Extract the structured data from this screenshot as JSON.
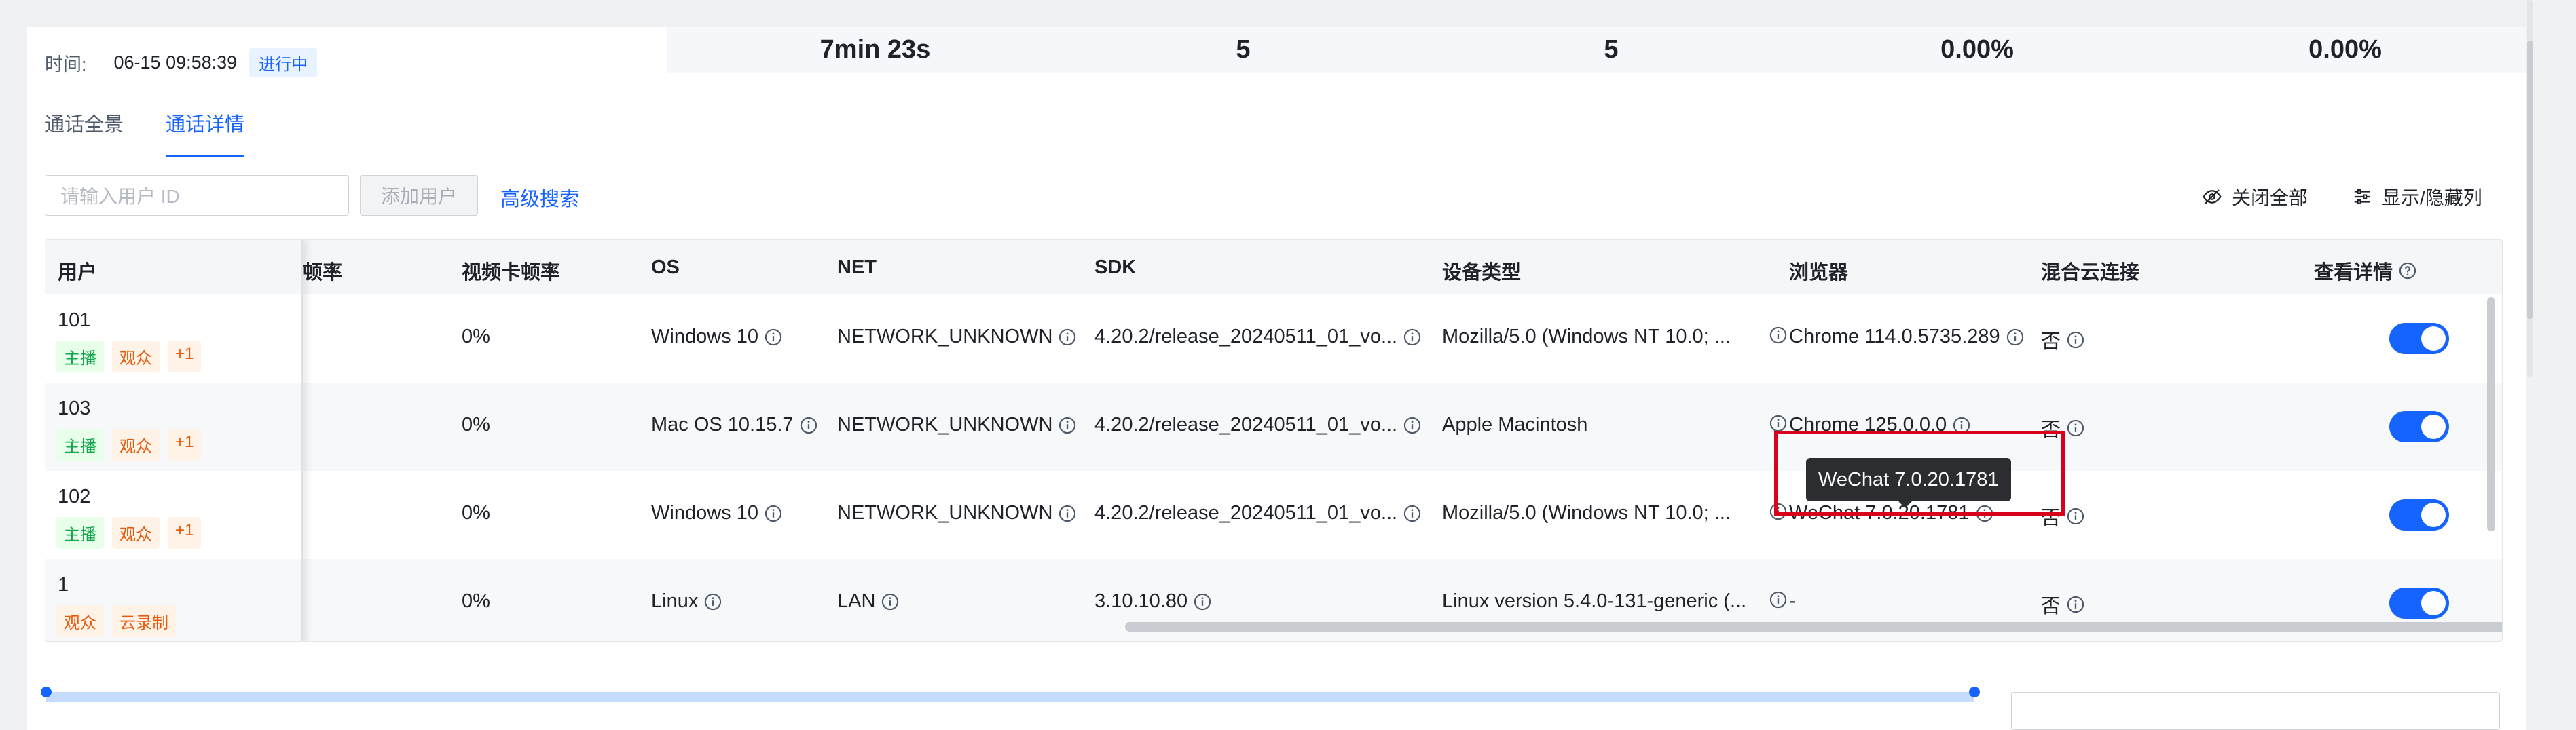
{
  "header": {
    "time_label": "时间:",
    "time_value": "06-15 09:58:39",
    "status": "进行中",
    "stats": [
      "7min 23s",
      "5",
      "5",
      "0.00%",
      "0.00%"
    ]
  },
  "tabs": [
    {
      "label": "通话全景",
      "active": false
    },
    {
      "label": "通话详情",
      "active": true
    }
  ],
  "toolbar": {
    "search_placeholder": "请输入用户 ID",
    "add_user_label": "添加用户",
    "advanced_search_label": "高级搜索",
    "close_all_label": "关闭全部",
    "toggle_columns_label": "显示/隐藏列"
  },
  "table": {
    "columns": {
      "user": "用户",
      "audio_stall": "卡顿率",
      "video_stall": "视频卡顿率",
      "os": "OS",
      "net": "NET",
      "sdk": "SDK",
      "device": "设备类型",
      "browser": "浏览器",
      "hybrid": "混合云连接",
      "details": "查看详情"
    },
    "rows": [
      {
        "user": "101",
        "tags": [
          "主播",
          "观众",
          "+1"
        ],
        "video_stall": "0%",
        "os": "Windows 10",
        "net": "NETWORK_UNKNOWN",
        "sdk": "4.20.2/release_20240511_01_vo...",
        "device": "Mozilla/5.0 (Windows NT 10.0; ...",
        "browser": "Chrome 114.0.5735.289",
        "hybrid": "否",
        "details_on": true
      },
      {
        "user": "103",
        "tags": [
          "主播",
          "观众",
          "+1"
        ],
        "video_stall": "0%",
        "os": "Mac OS 10.15.7",
        "net": "NETWORK_UNKNOWN",
        "sdk": "4.20.2/release_20240511_01_vo...",
        "device": "Apple Macintosh",
        "browser": "Chrome 125.0.0.0",
        "hybrid": "否",
        "details_on": true
      },
      {
        "user": "102",
        "tags": [
          "主播",
          "观众",
          "+1"
        ],
        "video_stall": "0%",
        "os": "Windows 10",
        "net": "NETWORK_UNKNOWN",
        "sdk": "4.20.2/release_20240511_01_vo...",
        "device": "Mozilla/5.0 (Windows NT 10.0; ...",
        "browser": "WeChat 7.0.20.1781",
        "hybrid": "否",
        "details_on": true
      },
      {
        "user": "1",
        "tags": [
          "观众",
          "云录制"
        ],
        "video_stall": "0%",
        "os": "Linux",
        "net": "LAN",
        "sdk": "3.10.10.80",
        "device": "Linux version 5.4.0-131-generic (...",
        "browser": "-",
        "hybrid": "否",
        "details_on": true
      }
    ]
  },
  "tooltip": "WeChat 7.0.20.1781",
  "colors": {
    "accent": "#1664ff",
    "highlight": "#d9001b",
    "tag_green": "#14a44d",
    "tag_orange": "#e8590c"
  }
}
